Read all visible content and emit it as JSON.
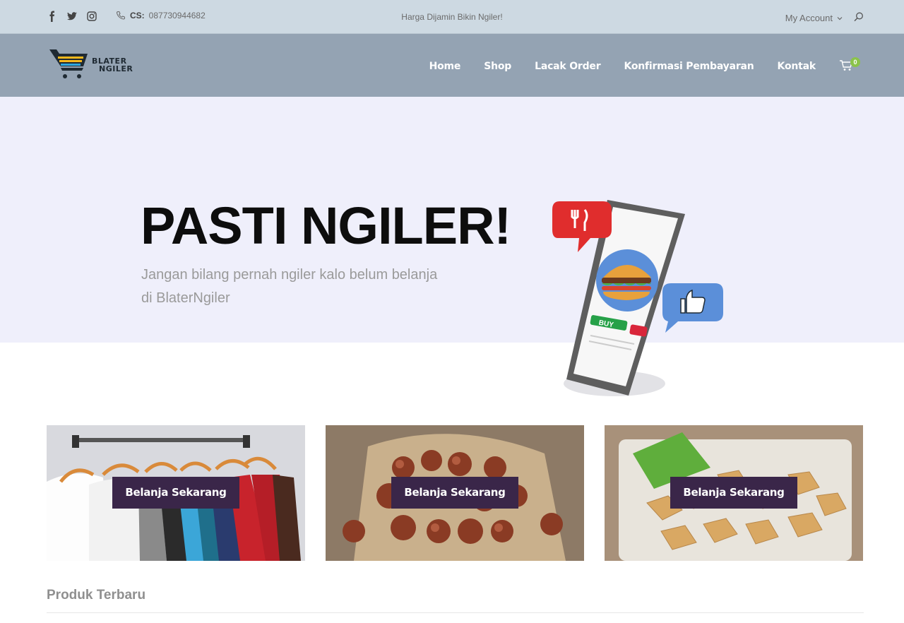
{
  "topbar": {
    "social_icons": [
      "facebook-icon",
      "twitter-icon",
      "instagram-icon"
    ],
    "cs_label": "CS:",
    "cs_phone": "087730944682",
    "tagline": "Harga Dijamin Bikin Ngiler!",
    "account_label": "My Account"
  },
  "header": {
    "logo_line1": "BLATER",
    "logo_line2": "NGILER",
    "nav": [
      "Home",
      "Shop",
      "Lacak Order",
      "Konfirmasi Pembayaran",
      "Kontak"
    ],
    "cart_count": "0"
  },
  "hero": {
    "title": "PASTI NGILER!",
    "subtitle": "Jangan bilang pernah ngiler kalo belum belanja di BlaterNgiler",
    "illustration_buy_label": "BUY"
  },
  "cards": [
    {
      "button": "Belanja Sekarang",
      "image": "clothes-on-rack"
    },
    {
      "button": "Belanja Sekarang",
      "image": "fried-snacks-basket"
    },
    {
      "button": "Belanja Sekarang",
      "image": "tofu-crackers"
    }
  ],
  "section": {
    "title": "Produk Terbaru"
  },
  "colors": {
    "topbar_bg": "#cdd9e2",
    "header_bg": "#94a3b3",
    "hero_bg": "#efeffb",
    "button_bg": "#3a2649",
    "cart_badge": "#8bc34a"
  }
}
